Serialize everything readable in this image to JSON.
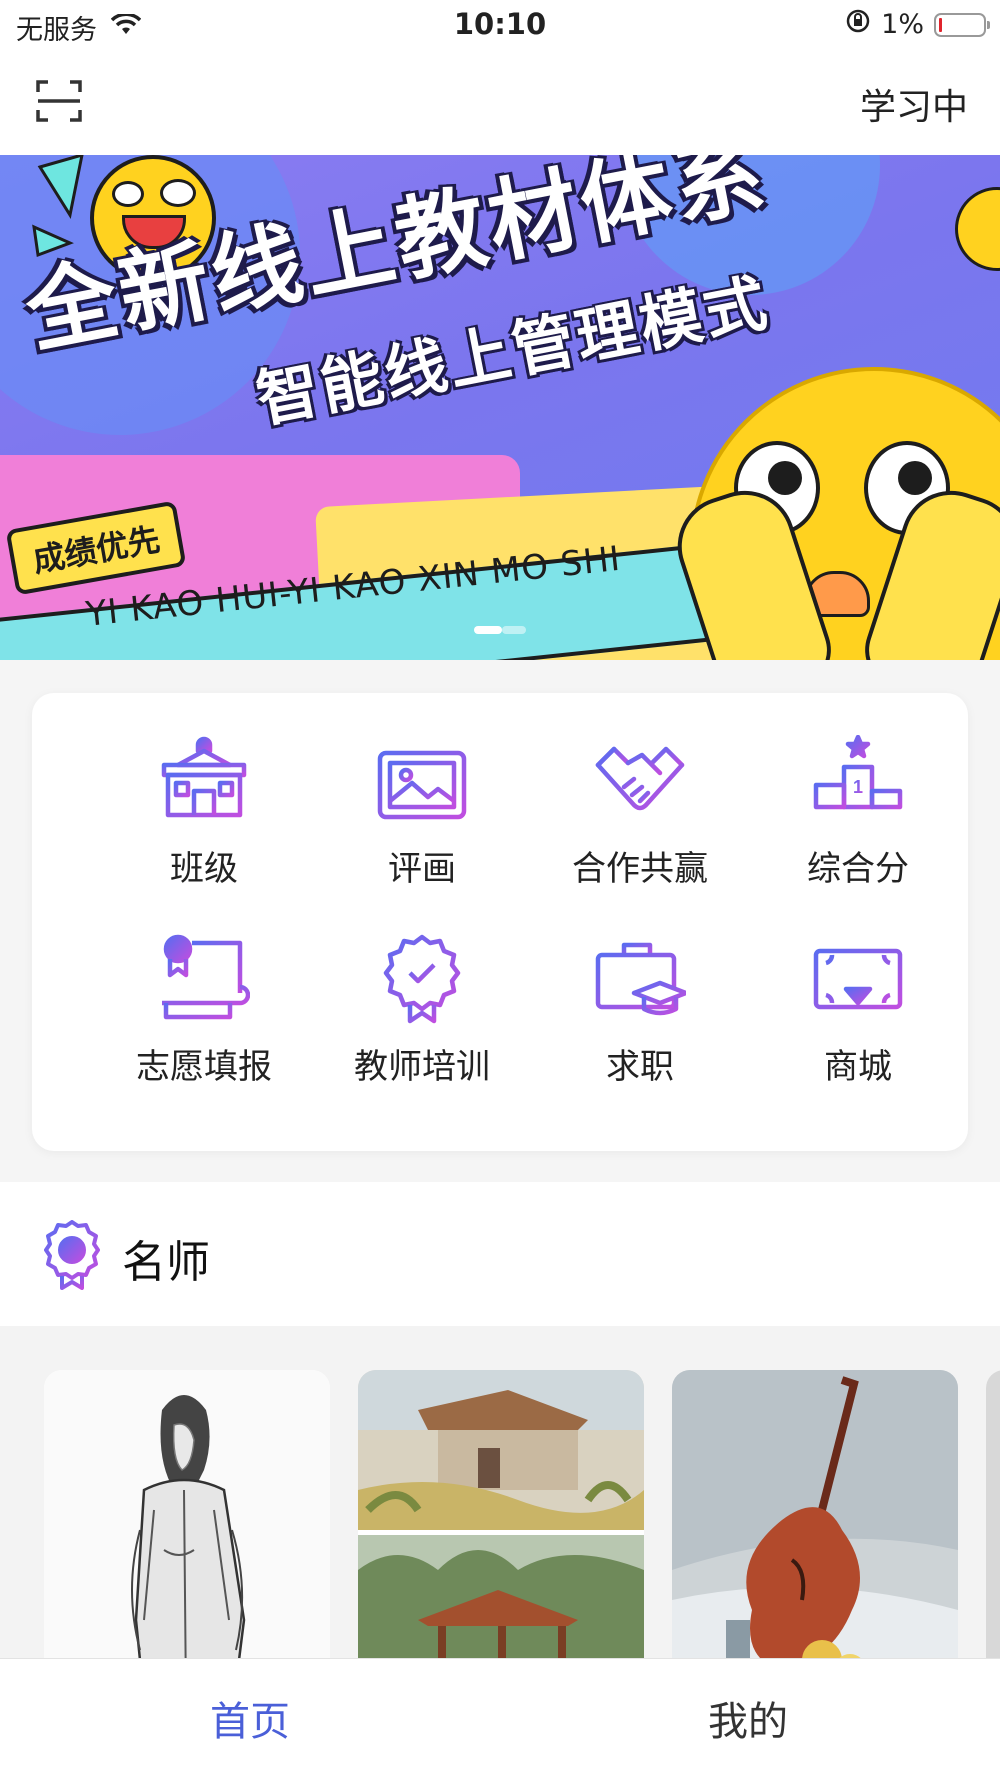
{
  "status_bar": {
    "carrier": "无服务",
    "time": "10:10",
    "battery": "1%",
    "icons": [
      "wifi-icon",
      "orientation-lock-icon",
      "battery-icon"
    ]
  },
  "nav": {
    "scan_icon": "scan-icon",
    "right_label": "学习中"
  },
  "banner": {
    "title_line1": "全新线上教材体系",
    "title_line2": "智能线上管理模式",
    "badge": "成绩优先",
    "pinyin": "YI KAO HUI-YI KAO XIN MO SHI",
    "page_count": 2,
    "active_page": 1
  },
  "menu": {
    "items": [
      {
        "label": "班级",
        "icon": "school-building-icon"
      },
      {
        "label": "评画",
        "icon": "picture-frame-icon"
      },
      {
        "label": "合作共赢",
        "icon": "handshake-icon"
      },
      {
        "label": "综合分",
        "icon": "podium-icon"
      },
      {
        "label": "志愿填报",
        "icon": "certificate-scroll-icon"
      },
      {
        "label": "教师培训",
        "icon": "award-badge-icon"
      },
      {
        "label": "求职",
        "icon": "briefcase-graduation-icon"
      },
      {
        "label": "商城",
        "icon": "shopping-download-icon"
      }
    ],
    "accent_from": "#5b6cf0",
    "accent_to": "#c04ee0"
  },
  "section": {
    "title": "名师",
    "icon": "medal-icon"
  },
  "gallery": {
    "cards": [
      {
        "subject": "pencil-sketch-figure"
      },
      {
        "subject": "oil-painting-village-pavilion"
      },
      {
        "subject": "oil-painting-cello-still-life"
      }
    ]
  },
  "tabs": {
    "items": [
      {
        "label": "首页",
        "active": true
      },
      {
        "label": "我的",
        "active": false
      }
    ],
    "active_color": "#4a5fd8"
  }
}
